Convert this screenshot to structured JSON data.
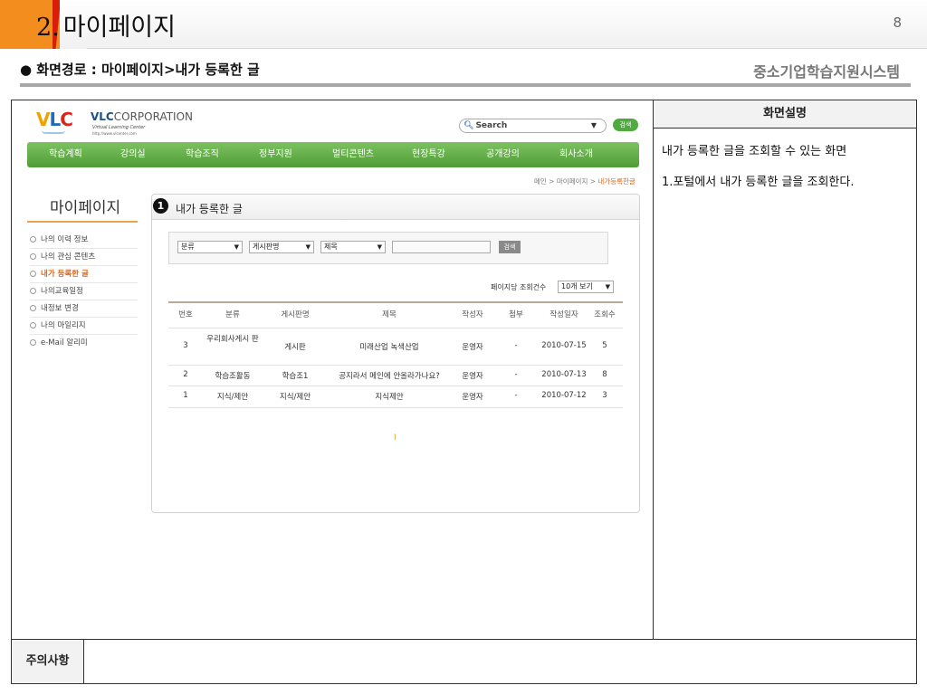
{
  "slide": {
    "number": "2.",
    "title": "마이페이지",
    "page_number": "8",
    "path": "● 화면경로 : 마이페이지>내가 등록한 글",
    "system_name": "중소기업학습지원시스템"
  },
  "description": {
    "header": "화면설명",
    "line1": "내가 등록한 글을 조회할 수 있는 화면",
    "line2": "1.포털에서 내가 등록한 글을 조회한다."
  },
  "caution": {
    "label": "주의사항",
    "text": ""
  },
  "portal": {
    "logo": {
      "v": "V",
      "l": "L",
      "c": "C"
    },
    "corp": {
      "bold": "VLC",
      "name": "CORPORATION",
      "sub1": "Virtual Learning Center",
      "sub2": "http://www.vlcenter.com"
    },
    "search": {
      "placeholder": "Search",
      "button": "검색"
    },
    "gnb": [
      "학습계획",
      "강의실",
      "학습조직",
      "정부지원",
      "멀티콘텐츠",
      "현장특강",
      "공개강의",
      "회사소개"
    ],
    "breadcrumb": {
      "path": "메인 > 마이페이지 > ",
      "current": "내가등록한글"
    },
    "lnb": {
      "title": "마이페이지",
      "items": [
        "나의 이력 정보",
        "나의 관심 콘텐츠",
        "내가 등록한 글",
        "나의교육일정",
        "내정보 변경",
        "나의 마일리지",
        "e-Mail 알리미"
      ],
      "active_index": 2
    },
    "content": {
      "marker": "1",
      "title": "내가 등록한 글",
      "filters": {
        "category": "분류",
        "board": "게시판명",
        "subject": "제목",
        "button": "검색"
      },
      "per_page_label": "페이지당 조회건수",
      "per_page_value": "10개 보기",
      "table": {
        "headers": [
          "번호",
          "분류",
          "게시판명",
          "제목",
          "작성자",
          "첨부",
          "작성일자",
          "조회수"
        ],
        "rows": [
          [
            "3",
            "우리회사게시 판",
            "게시판",
            "미래산업 녹색산업",
            "운영자",
            "-",
            "2010-07-15",
            "5"
          ],
          [
            "2",
            "학습조활동",
            "학습조1",
            "공지라서 메인에 안올라가나요?",
            "운영자",
            "-",
            "2010-07-13",
            "8"
          ],
          [
            "1",
            "지식/제안",
            "지식/제안",
            "지식제안",
            "운영자",
            "-",
            "2010-07-12",
            "3"
          ]
        ]
      },
      "cursor": "I"
    }
  }
}
